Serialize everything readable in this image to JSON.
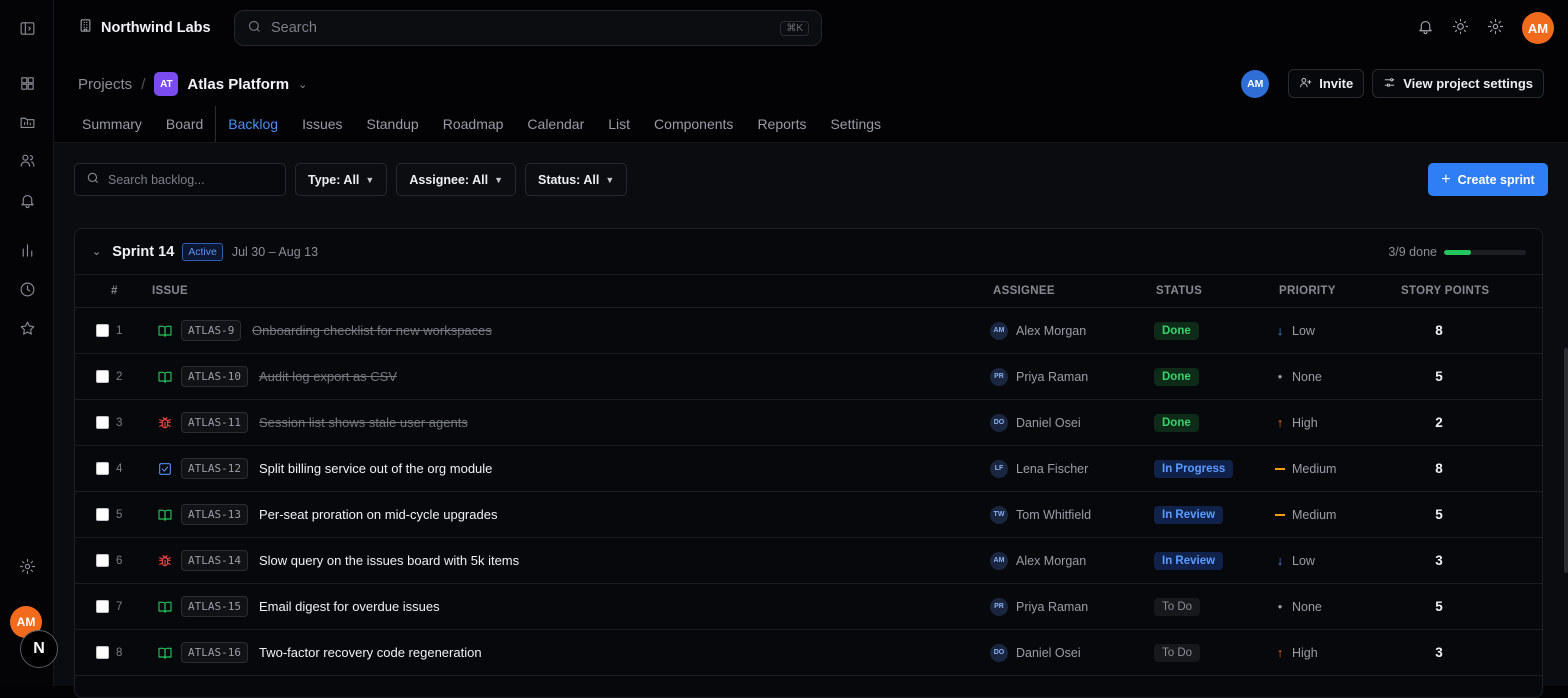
{
  "org": "Northwind Labs",
  "search_placeholder": "Search",
  "search_shortcut": "⌘K",
  "user_initials": "AM",
  "rail_avatar": "AM",
  "next_badge": "N",
  "breadcrumb": {
    "root": "Projects",
    "sep": "/",
    "project_initials": "AT",
    "project": "Atlas Platform"
  },
  "header_avatar": "AM",
  "invite_label": "Invite",
  "settings_label": "View project settings",
  "tabs": [
    "Summary",
    "Board",
    "Backlog",
    "Issues",
    "Standup",
    "Roadmap",
    "Calendar",
    "List",
    "Components",
    "Reports",
    "Settings"
  ],
  "active_tab": "Backlog",
  "filters": {
    "search_placeholder": "Search backlog...",
    "type": "Type: All",
    "assignee": "Assignee: All",
    "status": "Status: All"
  },
  "create_sprint": "Create sprint",
  "sprint": {
    "name": "Sprint 14",
    "badge": "Active",
    "dates": "Jul 30 – Aug 13",
    "progress_text": "3/9 done",
    "progress_fraction": 0.333
  },
  "columns": {
    "num": "#",
    "issue": "ISSUE",
    "assignee": "ASSIGNEE",
    "status": "STATUS",
    "priority": "PRIORITY",
    "points": "STORY POINTS"
  },
  "colors": {
    "accent": "#2f7ef6",
    "done": "#37d36b",
    "story": "#22c55e",
    "bug": "#ef4444",
    "task": "#4d8ef7",
    "high": "#f97316",
    "medium": "#f59e0b",
    "low": "#4d8ef7"
  },
  "issues": [
    {
      "num": "1",
      "type": "story",
      "key": "ATLAS-9",
      "title": "Onboarding checklist for new workspaces",
      "done": true,
      "initials": "AM",
      "assignee": "Alex Morgan",
      "status": "Done",
      "priority": "Low",
      "points": "8"
    },
    {
      "num": "2",
      "type": "story",
      "key": "ATLAS-10",
      "title": "Audit log export as CSV",
      "done": true,
      "initials": "PR",
      "assignee": "Priya Raman",
      "status": "Done",
      "priority": "None",
      "points": "5"
    },
    {
      "num": "3",
      "type": "bug",
      "key": "ATLAS-11",
      "title": "Session list shows stale user agents",
      "done": true,
      "initials": "DO",
      "assignee": "Daniel Osei",
      "status": "Done",
      "priority": "High",
      "points": "2"
    },
    {
      "num": "4",
      "type": "task",
      "key": "ATLAS-12",
      "title": "Split billing service out of the org module",
      "done": false,
      "initials": "LF",
      "assignee": "Lena Fischer",
      "status": "In Progress",
      "priority": "Medium",
      "points": "8"
    },
    {
      "num": "5",
      "type": "story",
      "key": "ATLAS-13",
      "title": "Per-seat proration on mid-cycle upgrades",
      "done": false,
      "initials": "TW",
      "assignee": "Tom Whitfield",
      "status": "In Review",
      "priority": "Medium",
      "points": "5"
    },
    {
      "num": "6",
      "type": "bug",
      "key": "ATLAS-14",
      "title": "Slow query on the issues board with 5k items",
      "done": false,
      "initials": "AM",
      "assignee": "Alex Morgan",
      "status": "In Review",
      "priority": "Low",
      "points": "3"
    },
    {
      "num": "7",
      "type": "story",
      "key": "ATLAS-15",
      "title": "Email digest for overdue issues",
      "done": false,
      "initials": "PR",
      "assignee": "Priya Raman",
      "status": "To Do",
      "priority": "None",
      "points": "5"
    },
    {
      "num": "8",
      "type": "story",
      "key": "ATLAS-16",
      "title": "Two-factor recovery code regeneration",
      "done": false,
      "initials": "DO",
      "assignee": "Daniel Osei",
      "status": "To Do",
      "priority": "High",
      "points": "3"
    }
  ]
}
